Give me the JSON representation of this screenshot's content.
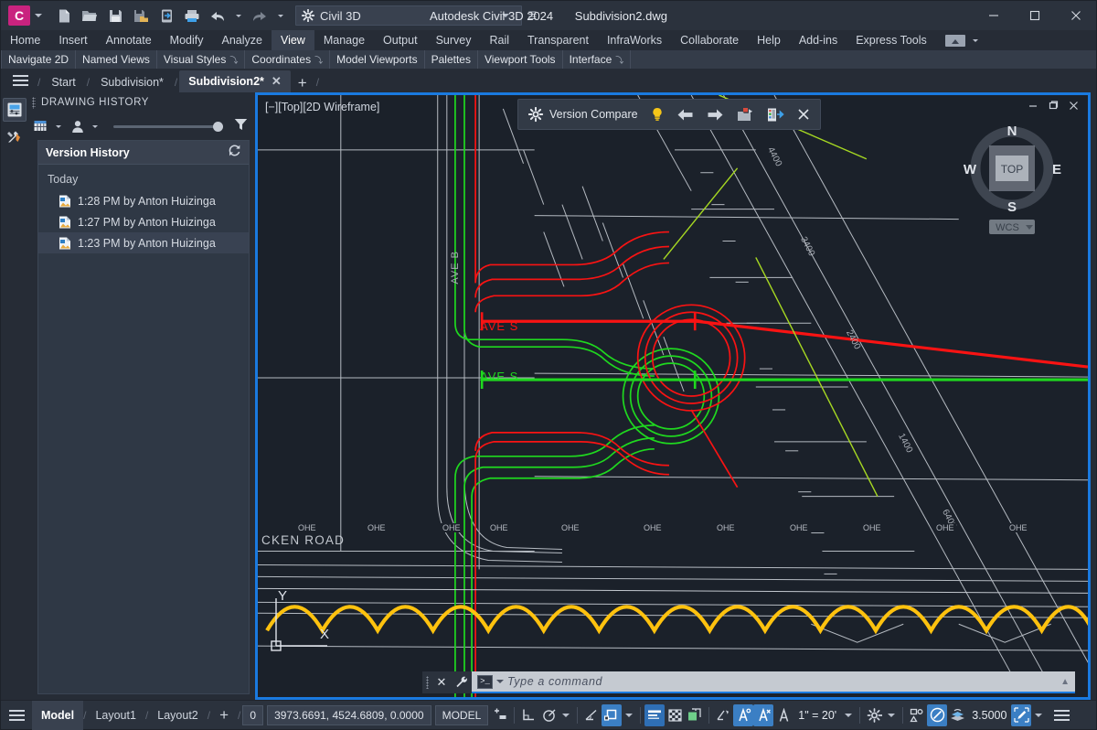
{
  "titlebar": {
    "logo_letter": "C",
    "workspace": "Civil 3D",
    "product": "Autodesk Civil 3D 2024",
    "document": "Subdivision2.dwg",
    "quick_access": [
      {
        "name": "new-icon",
        "label": "New"
      },
      {
        "name": "open-icon",
        "label": "Open"
      },
      {
        "name": "save-icon",
        "label": "Save"
      },
      {
        "name": "saveas-icon",
        "label": "Save As"
      },
      {
        "name": "publish-icon",
        "label": "Publish"
      },
      {
        "name": "print-icon",
        "label": "Plot"
      },
      {
        "name": "undo-icon",
        "label": "Undo"
      },
      {
        "name": "redo-icon",
        "label": "Redo"
      }
    ],
    "window_buttons": [
      {
        "name": "minimize-button",
        "glyph": "—"
      },
      {
        "name": "maximize-button",
        "glyph": "□"
      },
      {
        "name": "close-button",
        "glyph": "✕"
      }
    ]
  },
  "ribbon": {
    "tabs": [
      {
        "label": "Home",
        "active": false
      },
      {
        "label": "Insert",
        "active": false
      },
      {
        "label": "Annotate",
        "active": false
      },
      {
        "label": "Modify",
        "active": false
      },
      {
        "label": "Analyze",
        "active": false
      },
      {
        "label": "View",
        "active": true
      },
      {
        "label": "Manage",
        "active": false
      },
      {
        "label": "Output",
        "active": false
      },
      {
        "label": "Survey",
        "active": false
      },
      {
        "label": "Rail",
        "active": false
      },
      {
        "label": "Transparent",
        "active": false
      },
      {
        "label": "InfraWorks",
        "active": false
      },
      {
        "label": "Collaborate",
        "active": false
      },
      {
        "label": "Help",
        "active": false
      },
      {
        "label": "Add-ins",
        "active": false
      },
      {
        "label": "Express Tools",
        "active": false
      }
    ],
    "panels": [
      {
        "label": "Navigate 2D",
        "arrow": ""
      },
      {
        "label": "Named Views",
        "arrow": ""
      },
      {
        "label": "Visual Styles",
        "arrow": "⤵"
      },
      {
        "label": "Coordinates",
        "arrow": "⤵"
      },
      {
        "label": "Model Viewports",
        "arrow": ""
      },
      {
        "label": "Palettes",
        "arrow": ""
      },
      {
        "label": "Viewport Tools",
        "arrow": ""
      },
      {
        "label": "Interface",
        "arrow": "⤵"
      }
    ]
  },
  "filetabs": {
    "separator": "/",
    "tabs": [
      {
        "label": "Start",
        "active": false,
        "closable": false
      },
      {
        "label": "Subdivision*",
        "active": false,
        "closable": false
      },
      {
        "label": "Subdivision2*",
        "active": true,
        "closable": true,
        "close_glyph": "✕"
      }
    ],
    "add_glyph": "+"
  },
  "palette": {
    "title": "DRAWING HISTORY",
    "toolbar": {
      "grid_filter": "grid-filter-dropdown",
      "person_filter": "person-filter-dropdown",
      "filter_icon": "funnel-icon"
    },
    "card": {
      "header": "Version History",
      "refresh_icon": "refresh-icon",
      "group_label": "Today",
      "items": [
        {
          "label": "1:28 PM by Anton Huizinga",
          "selected": false
        },
        {
          "label": "1:27 PM by Anton Huizinga",
          "selected": false
        },
        {
          "label": "1:23 PM by Anton Huizinga",
          "selected": true
        }
      ]
    }
  },
  "rail": {
    "buttons": [
      {
        "name": "toolspace-icon",
        "selected": true
      },
      {
        "name": "tools-icon",
        "selected": false
      }
    ]
  },
  "viewport": {
    "label": "[−][Top][2D Wireframe]",
    "window_buttons": [
      {
        "name": "vp-minimize-button",
        "glyph": "—"
      },
      {
        "name": "vp-restore-button",
        "glyph": "□"
      },
      {
        "name": "vp-close-button",
        "glyph": "✕"
      }
    ],
    "navcube": {
      "top_face": "TOP",
      "north": "N",
      "south": "S",
      "east": "E",
      "west": "W",
      "ucs": "WCS"
    },
    "version_compare": {
      "gear_icon": "settings-icon",
      "title": "Version Compare",
      "bulb_icon": "lightbulb-icon",
      "prev_icon": "arrow-left-icon",
      "next_icon": "arrow-right-icon",
      "copy_icon": "copy-from-previous-icon",
      "compare_icon": "compare-panel-icon",
      "close_icon": "close-icon",
      "close_glyph": "✕"
    },
    "drawing": {
      "street_labels": [
        "AVE B",
        "AVE S",
        "AVE S",
        "CKEN ROAD"
      ],
      "parcel_labels": [
        "4400",
        "3400",
        "2400",
        "1400",
        "6400"
      ],
      "utility_label": "OHE",
      "ucs_icon": {
        "x": "X",
        "y": "Y"
      },
      "colors": {
        "new_version": "#1fd81f",
        "old_version": "#f91313",
        "base": "#c8ccd2",
        "highlight": "#ffc20e",
        "accent": "#a6d822"
      }
    }
  },
  "command_line": {
    "close_glyph": "✕",
    "wrench_icon": "customize-icon",
    "prompt_icon": "command-prompt-icon",
    "placeholder": "Type a command",
    "value": "",
    "expand_glyph": "▲"
  },
  "statusbar": {
    "layout_tabs": [
      {
        "label": "Model",
        "active": true
      },
      {
        "label": "Layout1",
        "active": false
      },
      {
        "label": "Layout2",
        "active": false
      }
    ],
    "add_layout_glyph": "+",
    "separator": "/",
    "counter": "0",
    "coordinates": "3973.6691, 4524.6809, 0.0000",
    "space": "MODEL",
    "scale": "1\" = 20'",
    "lineweight_value": "3.5000",
    "toggles": [
      {
        "name": "infer-constraints-icon",
        "on": false
      },
      {
        "name": "ortho-mode-icon",
        "on": false
      },
      {
        "name": "polar-tracking-icon",
        "on": false
      },
      {
        "name": "isodraft-icon",
        "on": false
      },
      {
        "name": "object-snap-tracking-icon",
        "on": true
      },
      {
        "name": "lineweight-display-icon",
        "on": true
      },
      {
        "name": "transparency-display-icon",
        "on": false
      },
      {
        "name": "selection-cycling-icon",
        "on": false
      },
      {
        "name": "annotation-visibility-icon",
        "on": false
      },
      {
        "name": "autoscale-icon",
        "on": true
      },
      {
        "name": "annotation-scale-icon",
        "on": true
      },
      {
        "name": "workspace-switching-icon",
        "on": false
      },
      {
        "name": "hardware-accel-icon",
        "on": false
      },
      {
        "name": "isolate-objects-icon",
        "on": true
      },
      {
        "name": "lineweight-swatch-icon",
        "on": false
      },
      {
        "name": "customization-icon",
        "on": false
      }
    ]
  },
  "theme": {
    "accent": "#1a7ae0",
    "chrome": "#262c36",
    "chrome_light": "#39414f",
    "canvas": "#0f1419",
    "text": "#dfe3ea"
  }
}
